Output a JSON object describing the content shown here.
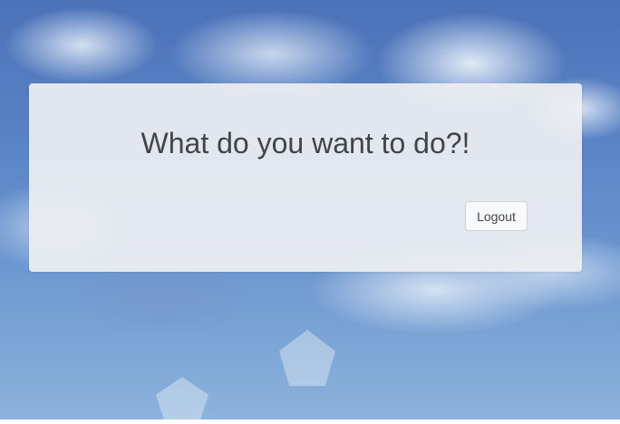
{
  "panel": {
    "title": "What do you want to do?!"
  },
  "actions": {
    "logout_label": "Logout"
  }
}
